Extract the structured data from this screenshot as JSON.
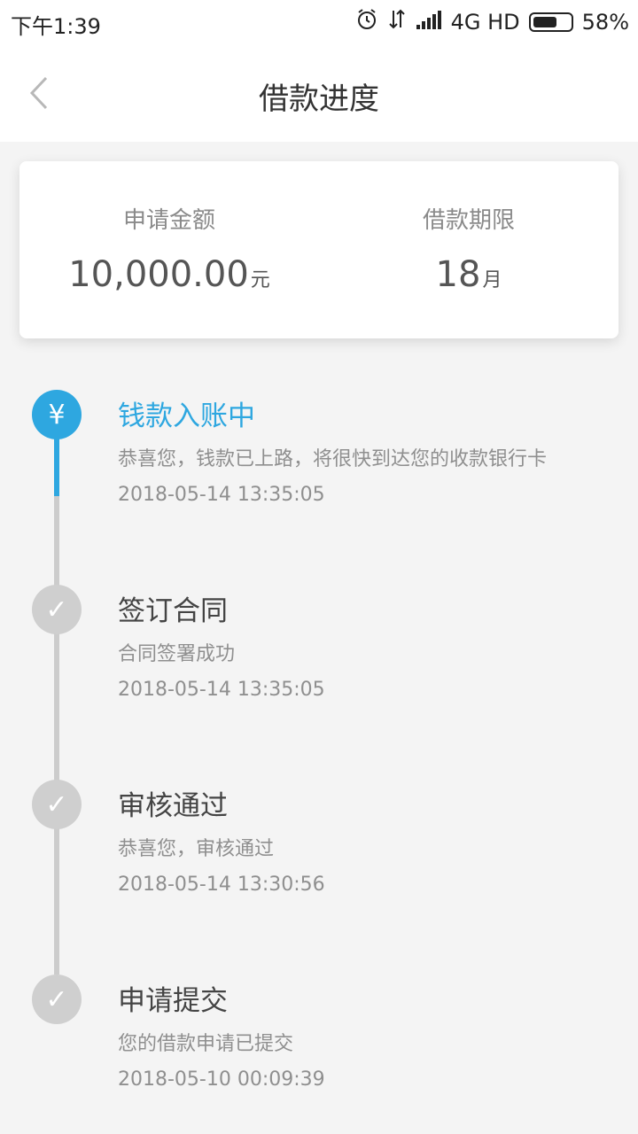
{
  "status_bar": {
    "time": "下午1:39",
    "network": "4G HD",
    "battery": "58%",
    "icons": [
      "alarm-icon",
      "data-arrows-icon",
      "signal-icon",
      "battery-icon"
    ]
  },
  "header": {
    "title": "借款进度",
    "back_icon": "chevron-left-icon"
  },
  "summary": {
    "amount_label": "申请金额",
    "amount_value": "10,000.00",
    "amount_unit": "元",
    "term_label": "借款期限",
    "term_value": "18",
    "term_unit": "月"
  },
  "timeline": [
    {
      "title": "钱款入账中",
      "desc": "恭喜您，钱款已上路，将很快到达您的收款银行卡",
      "time": "2018-05-14 13:35:05",
      "icon": "¥",
      "icon_name": "yuan-icon",
      "active": true
    },
    {
      "title": "签订合同",
      "desc": "合同签署成功",
      "time": "2018-05-14 13:35:05",
      "icon": "✓",
      "icon_name": "check-icon",
      "active": false
    },
    {
      "title": "审核通过",
      "desc": "恭喜您，审核通过",
      "time": "2018-05-14 13:30:56",
      "icon": "✓",
      "icon_name": "check-icon",
      "active": false
    },
    {
      "title": "申请提交",
      "desc": "您的借款申请已提交",
      "time": "2018-05-10 00:09:39",
      "icon": "✓",
      "icon_name": "check-icon",
      "active": false
    }
  ],
  "colors": {
    "accent": "#2ea7e0",
    "inactive": "#cccccc"
  }
}
